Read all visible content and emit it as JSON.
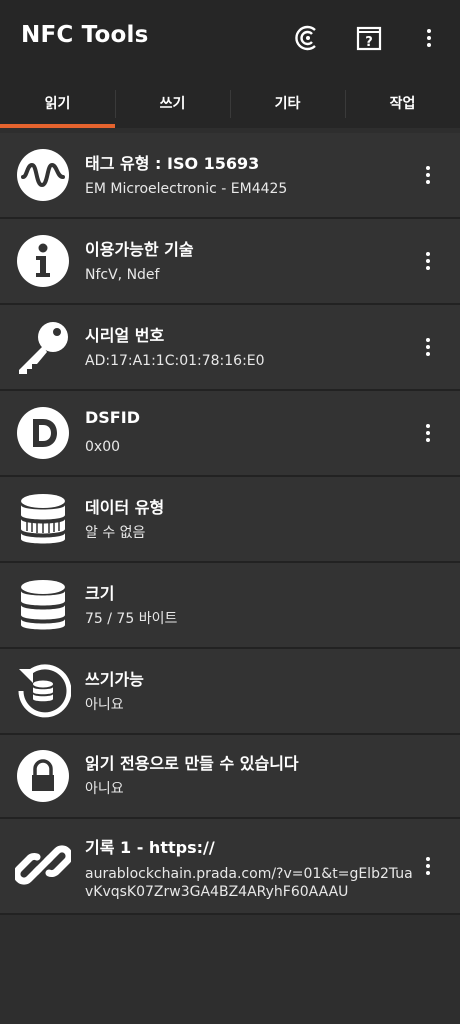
{
  "appbar": {
    "title": "NFC Tools"
  },
  "tabs": [
    {
      "label": "읽기",
      "active": true
    },
    {
      "label": "쓰기"
    },
    {
      "label": "기타"
    },
    {
      "label": "작업"
    }
  ],
  "colors": {
    "accent": "#e5632e",
    "background": "#2e2e2e",
    "appbar": "#262626"
  },
  "rows": [
    {
      "icon": "wave-icon",
      "title": "태그 유형 : ISO 15693",
      "sub": "EM Microelectronic - EM4425"
    },
    {
      "icon": "info-icon",
      "title": "이용가능한 기술",
      "sub": "NfcV, Ndef"
    },
    {
      "icon": "key-icon",
      "title": "시리얼 번호",
      "sub": "AD:17:A1:1C:01:78:16:E0"
    },
    {
      "icon": "d-letter-icon",
      "title": "DSFID",
      "sub": "0x00"
    },
    {
      "icon": "database-icon",
      "title": "데이터 유형",
      "sub": "알 수 없음"
    },
    {
      "icon": "database-icon",
      "title": "크기",
      "sub": "75 / 75 바이트"
    },
    {
      "icon": "database-refresh-icon",
      "title": "쓰기가능",
      "sub": "아니요"
    },
    {
      "icon": "lock-icon",
      "title": "읽기 전용으로 만들 수 있습니다",
      "sub": "아니요"
    },
    {
      "icon": "link-icon",
      "title": "기록 1 - https://",
      "sub": "aurablockchain.prada.com/?v=01&t=gElb2TuavKvqsK07Zrw3GA4BZ4ARyhF60AAAU"
    }
  ]
}
